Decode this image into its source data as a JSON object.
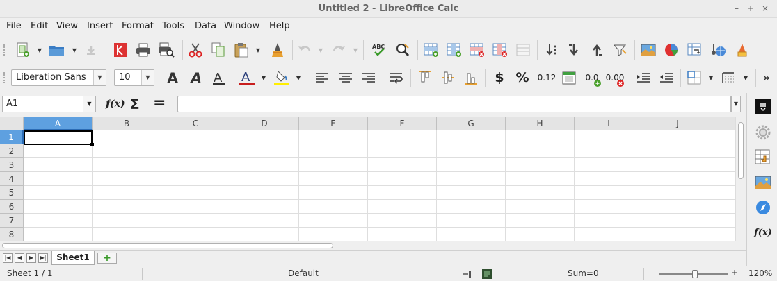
{
  "window": {
    "title": "Untitled 2 - LibreOffice Calc",
    "minimize": "–",
    "maximize": "+",
    "close": "×"
  },
  "menu": {
    "items": [
      {
        "id": "file",
        "label": "File"
      },
      {
        "id": "edit",
        "label": "Edit"
      },
      {
        "id": "view",
        "label": "View"
      },
      {
        "id": "insert",
        "label": "Insert"
      },
      {
        "id": "format",
        "label": "Format"
      },
      {
        "id": "tools",
        "label": "Tools"
      },
      {
        "id": "data",
        "label": "Data"
      },
      {
        "id": "window",
        "label": "Window"
      },
      {
        "id": "help",
        "label": "Help"
      }
    ]
  },
  "formatting": {
    "font_name": "Liberation Sans",
    "font_size": "10",
    "currency_symbol": "$",
    "percent_symbol": "%",
    "number_format": "0.12",
    "add_decimal": "0.0",
    "delete_decimal": "0.00",
    "more": "»"
  },
  "formula_bar": {
    "name_box": "A1",
    "function_wizard": "f(x)",
    "sum": "Σ",
    "equals": "=",
    "content": ""
  },
  "sheet": {
    "columns": [
      "A",
      "B",
      "C",
      "D",
      "E",
      "F",
      "G",
      "H",
      "I",
      "J"
    ],
    "rows": [
      "1",
      "2",
      "3",
      "4",
      "5",
      "6",
      "7",
      "8"
    ],
    "active_cell": "A1"
  },
  "tabs": {
    "sheets": [
      "Sheet1"
    ],
    "active": "Sheet1",
    "add": "+"
  },
  "status": {
    "sheet_position": "Sheet 1 / 1",
    "page_style": "Default",
    "sum": "Sum=0",
    "zoom_minus": "–",
    "zoom_plus": "+",
    "zoom": "120%"
  },
  "colors": {
    "selected_header": "#5ea0e0",
    "accent": "#2c6cb5"
  }
}
